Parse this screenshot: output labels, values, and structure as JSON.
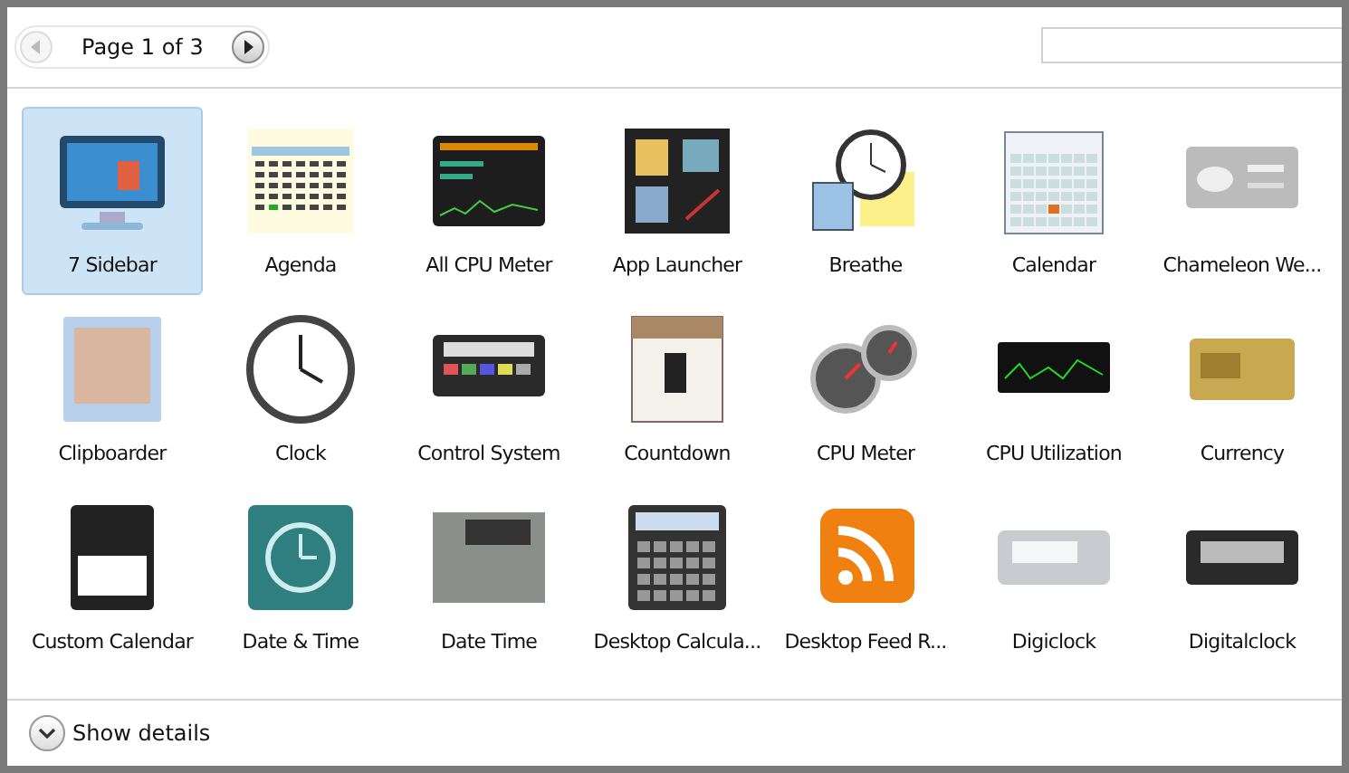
{
  "pager": {
    "label": "Page 1 of 3",
    "prev_disabled": true,
    "next_disabled": false
  },
  "gadgets": [
    {
      "name": "7 Sidebar",
      "kind": "monitor",
      "selected": true
    },
    {
      "name": "Agenda",
      "kind": "planner",
      "selected": false
    },
    {
      "name": "All CPU Meter",
      "kind": "meter",
      "selected": false
    },
    {
      "name": "App Launcher",
      "kind": "launcher",
      "selected": false
    },
    {
      "name": "Breathe",
      "kind": "clocknote",
      "selected": false
    },
    {
      "name": "Calendar",
      "kind": "calendar",
      "selected": false
    },
    {
      "name": "Chameleon We...",
      "kind": "weather",
      "selected": false
    },
    {
      "name": "Clipboarder",
      "kind": "photo",
      "selected": false
    },
    {
      "name": "Clock",
      "kind": "clock",
      "selected": false
    },
    {
      "name": "Control System",
      "kind": "device",
      "selected": false
    },
    {
      "name": "Countdown",
      "kind": "countdown",
      "selected": false
    },
    {
      "name": "CPU Meter",
      "kind": "gauge",
      "selected": false
    },
    {
      "name": "CPU Utilization",
      "kind": "graph",
      "selected": false
    },
    {
      "name": "Currency",
      "kind": "card",
      "selected": false
    },
    {
      "name": "Custom Calendar",
      "kind": "tearoff",
      "selected": false
    },
    {
      "name": "Date & Time",
      "kind": "clocktile",
      "selected": false
    },
    {
      "name": "Date Time",
      "kind": "snapshot",
      "selected": false
    },
    {
      "name": "Desktop Calcula...",
      "kind": "calculator",
      "selected": false
    },
    {
      "name": "Desktop Feed R...",
      "kind": "feed",
      "selected": false
    },
    {
      "name": "Digiclock",
      "kind": "digilight",
      "selected": false
    },
    {
      "name": "Digitalclock",
      "kind": "digidark",
      "selected": false
    }
  ],
  "footer": {
    "label": "Show details",
    "expanded": false
  }
}
